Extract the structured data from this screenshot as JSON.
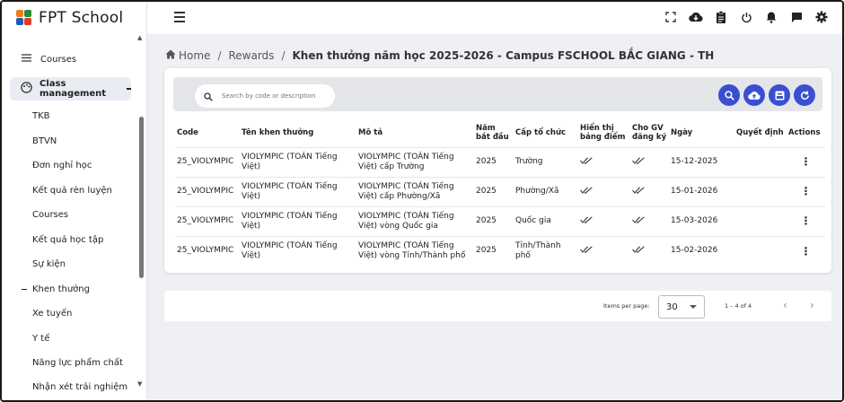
{
  "app": {
    "title": "FPT School"
  },
  "sidebar": {
    "courses": "Courses",
    "class_management": "Class management",
    "items": [
      {
        "label": "TKB"
      },
      {
        "label": "BTVN"
      },
      {
        "label": "Đơn nghỉ học"
      },
      {
        "label": "Kết quả rèn luyện"
      },
      {
        "label": "Courses"
      },
      {
        "label": "Kết quả học tập"
      },
      {
        "label": "Sự kiện"
      },
      {
        "label": "Khen thưởng"
      },
      {
        "label": "Xe tuyến"
      },
      {
        "label": "Y tế"
      },
      {
        "label": "Năng lực phẩm chất"
      },
      {
        "label": "Nhận xét trải nghiệm"
      }
    ]
  },
  "breadcrumb": {
    "home": "Home",
    "rewards": "Rewards",
    "current": "Khen thưởng năm học 2025-2026 - Campus FSCHOOL BẮC GIANG - TH"
  },
  "search": {
    "placeholder": "Search by code or description"
  },
  "table": {
    "headers": {
      "code": "Code",
      "name": "Tên khen thưởng",
      "description": "Mô tả",
      "start_year": "Năm bắt đầu",
      "level": "Cấp tổ chức",
      "show_grade": "Hiển thị bảng điểm",
      "gv_register": "Cho GV đăng ký",
      "date": "Ngày",
      "decision": "Quyết định",
      "actions": "Actions"
    },
    "rows": [
      {
        "code": "25_VIOLYMPIC",
        "name": "VIOLYMPIC (TOÁN Tiếng Việt)",
        "description": "VIOLYMPIC (TOÁN Tiếng Việt) cấp Trường",
        "start_year": "2025",
        "level": "Trường",
        "date": "15-12-2025"
      },
      {
        "code": "25_VIOLYMPIC",
        "name": "VIOLYMPIC (TOÁN Tiếng Việt)",
        "description": "VIOLYMPIC (TOÁN Tiếng Việt) cấp Phường/Xã",
        "start_year": "2025",
        "level": "Phường/Xã",
        "date": "15-01-2026"
      },
      {
        "code": "25_VIOLYMPIC",
        "name": "VIOLYMPIC (TOÁN Tiếng Việt)",
        "description": "VIOLYMPIC (TOÁN Tiếng Việt) vòng Quốc gia",
        "start_year": "2025",
        "level": "Quốc gia",
        "date": "15-03-2026"
      },
      {
        "code": "25_VIOLYMPIC",
        "name": "VIOLYMPIC (TOÁN Tiếng Việt)",
        "description": "VIOLYMPIC (TOÁN Tiếng Việt) vòng Tỉnh/Thành phố",
        "start_year": "2025",
        "level": "Tỉnh/Thành phố",
        "date": "15-02-2026"
      }
    ]
  },
  "pagination": {
    "items_per_page_label": "Items per page:",
    "items_per_page": "30",
    "range": "1 – 4 of 4"
  },
  "colors": {
    "accent": "#3a4fd0",
    "background": "#eef0f4"
  }
}
